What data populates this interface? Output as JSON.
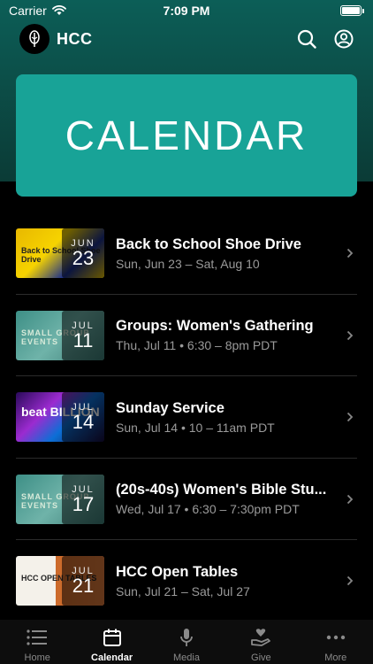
{
  "status_bar": {
    "carrier": "Carrier",
    "time": "7:09 PM"
  },
  "app": {
    "title": "HCC"
  },
  "banner": {
    "text": "CALENDAR"
  },
  "events": [
    {
      "month": "JUN",
      "day": "23",
      "title": "Back to School Shoe Drive",
      "subtitle": "Sun, Jun 23 – Sat, Aug 10",
      "thumb_text": "Back to School Shoe Drive"
    },
    {
      "month": "JUL",
      "day": "11",
      "title": "Groups: Women's Gathering",
      "subtitle": "Thu, Jul 11 • 6:30 – 8pm PDT",
      "thumb_text": "SMALL GROUP EVENTS"
    },
    {
      "month": "JUL",
      "day": "14",
      "title": "Sunday Service",
      "subtitle": "Sun, Jul 14 • 10 – 11am PDT",
      "thumb_text": "beat BILLION"
    },
    {
      "month": "JUL",
      "day": "17",
      "title": "(20s-40s) Women's Bible Stu...",
      "subtitle": "Wed, Jul 17 • 6:30 – 7:30pm PDT",
      "thumb_text": "SMALL GROUP EVENTS"
    },
    {
      "month": "JUL",
      "day": "21",
      "title": "HCC Open Tables",
      "subtitle": "Sun, Jul 21 – Sat, Jul 27",
      "thumb_text": "HCC OPEN TABLES"
    }
  ],
  "tabs": [
    {
      "label": "Home",
      "icon": "list-icon"
    },
    {
      "label": "Calendar",
      "icon": "calendar-icon"
    },
    {
      "label": "Media",
      "icon": "microphone-icon"
    },
    {
      "label": "Give",
      "icon": "give-hand-heart-icon"
    },
    {
      "label": "More",
      "icon": "more-dots-icon"
    }
  ],
  "colors": {
    "header": "#0c5e57",
    "banner": "#18a397",
    "background": "#000000"
  }
}
